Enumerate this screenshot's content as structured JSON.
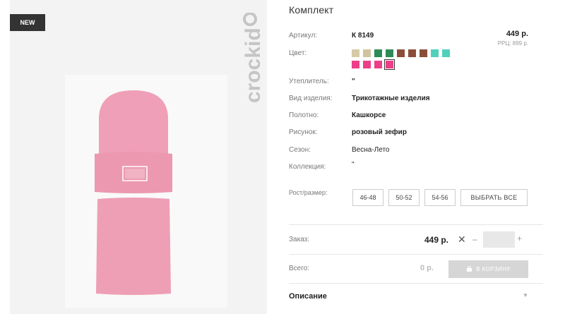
{
  "badge": "NEW",
  "brand": "crockid",
  "product": {
    "title": "Комплект",
    "price": "449 р.",
    "rrp": "РРЦ: 899 р."
  },
  "attributes": [
    {
      "label": "Артикул:",
      "value": "К 8149"
    },
    {
      "label": "Цвет:",
      "value": ""
    },
    {
      "label": "Утеплитель:",
      "value": "\""
    },
    {
      "label": "Вид изделия:",
      "value": "Трикотажные изделия"
    },
    {
      "label": "Полотно:",
      "value": "Кашкорсе"
    },
    {
      "label": "Рисунок:",
      "value": "розовый зефир"
    },
    {
      "label": "Сезон:",
      "value": "Весна-Лето"
    },
    {
      "label": "Коллекция:",
      "value": "\""
    }
  ],
  "colors": [
    "#d6c9a6",
    "#d2c3a0",
    "#2e8a57",
    "#2e8a57",
    "#8a4e3a",
    "#8a4e3a",
    "#8a4e3a",
    "#4fd0bd",
    "#4fd0bd",
    "#ec3f88",
    "#ec3f88",
    "#ec3f88",
    "#ec3f88"
  ],
  "selected_color_index": 12,
  "sizes": {
    "label": "Рост/размер:",
    "options": [
      "46-48",
      "50-52",
      "54-56"
    ],
    "select_all": "ВЫБРАТЬ ВСЕ"
  },
  "order": {
    "label": "Заказ:",
    "price": "449 р.",
    "times": "✕",
    "minus": "–",
    "quantity": "",
    "plus": "+"
  },
  "total": {
    "label": "Всего:",
    "price": "0 р.",
    "cart_button": "В КОРЗИНУ"
  },
  "description": {
    "label": "Описание",
    "chevron": "▼"
  },
  "icons": {
    "cart": "cart-icon",
    "chevron": "chevron-down-icon"
  }
}
